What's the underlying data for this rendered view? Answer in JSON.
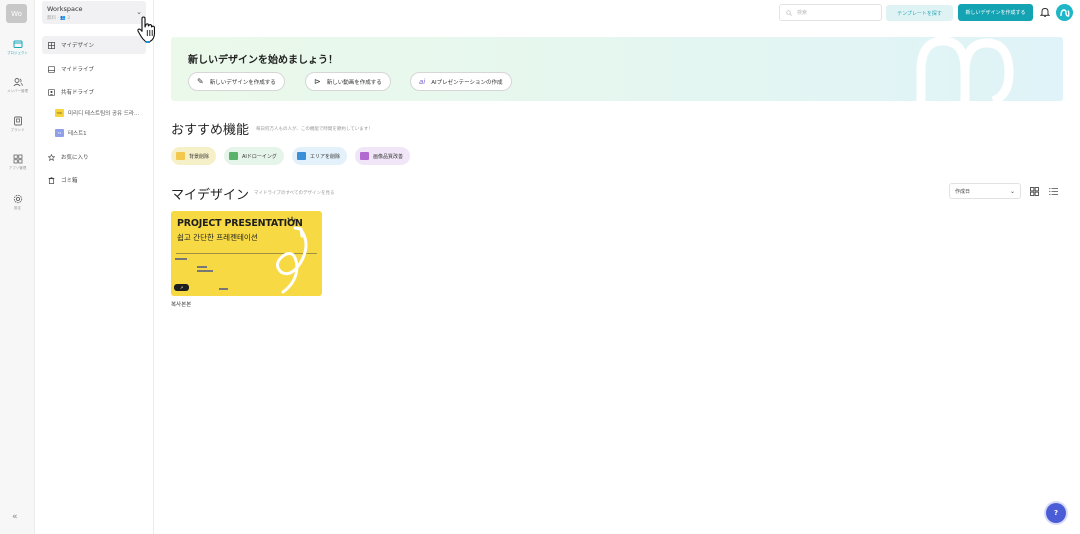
{
  "rail": {
    "avatar": "Wo",
    "items": [
      {
        "label": "プロジェクト",
        "icon": "folder-icon"
      },
      {
        "label": "メンバー管理",
        "icon": "people-icon"
      },
      {
        "label": "ブランド",
        "icon": "brand-icon"
      },
      {
        "label": "アプリ管理",
        "icon": "apps-icon"
      },
      {
        "label": "設定",
        "icon": "settings-icon"
      }
    ],
    "collapse": "«"
  },
  "workspace": {
    "name": "Workspace",
    "sub": "無料 · 👥 2",
    "chevron": "⌄"
  },
  "sidebar": {
    "items": [
      {
        "label": "マイデザイン",
        "icon": "grid-icon"
      },
      {
        "label": "マイドライブ",
        "icon": "drive-icon"
      },
      {
        "label": "共有ドライブ",
        "icon": "shared-drive-icon"
      },
      {
        "label": "お気に入り",
        "icon": "star-icon"
      },
      {
        "label": "ゴミ箱",
        "icon": "trash-icon"
      }
    ],
    "shared": [
      {
        "label": "미리디 테스트팀의 공유 드라...",
        "thumb": "미리디",
        "color": "#f6d43a"
      },
      {
        "label": "테스트1",
        "thumb": "T1",
        "color": "#8fa0e8"
      }
    ]
  },
  "topbar": {
    "search_placeholder": "検索",
    "template_button": "テンプレートを探す",
    "new_design_button": "新しいデザインを作成する"
  },
  "hero": {
    "title": "新しいデザインを始めましょう！",
    "actions": [
      {
        "label": "新しいデザインを作成する",
        "icon": "pencil-icon"
      },
      {
        "label": "新しい動画を作成する",
        "icon": "play-circle-icon"
      },
      {
        "label": "AIプレゼンテーションの作成",
        "icon": "ai-icon",
        "prefix": "ai"
      }
    ]
  },
  "recommended": {
    "title": "おすすめ機能",
    "subtitle": "毎日何万人もの人が、この機能で時間を節約しています！",
    "features": [
      {
        "label": "背景削除",
        "color": "#f6f0c9",
        "icon_color": "#f2c94c"
      },
      {
        "label": "AIドローイング",
        "color": "#e6f5ea",
        "icon_color": "#5ab36a"
      },
      {
        "label": "エリアを削除",
        "color": "#e3f1fb",
        "icon_color": "#3b8ed8"
      },
      {
        "label": "画像品質改善",
        "color": "#f0e6f7",
        "icon_color": "#b06ad0"
      }
    ]
  },
  "my_designs": {
    "title": "マイデザイン",
    "subtitle": "マイドライブのすべてのデザインを見る",
    "sort": "作成日",
    "cards": [
      {
        "headline": "PROJECT PRESENTATION",
        "subhead": "쉽고 간단한 프레젠테이션",
        "badge": "↗",
        "name": "복사본본"
      }
    ]
  },
  "help": "?"
}
